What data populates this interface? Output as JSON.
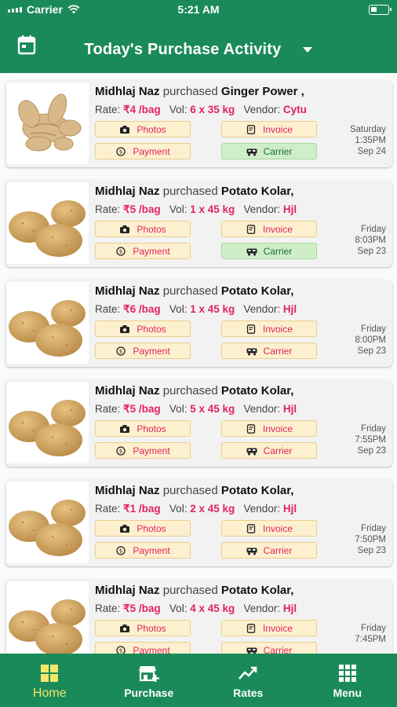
{
  "status": {
    "carrier": "Carrier",
    "time": "5:21 AM"
  },
  "header": {
    "title": "Today's Purchase Activity",
    "calendar_icon": "calendar-icon",
    "dropdown_icon": "caret-down-icon"
  },
  "labels": {
    "purchased": "purchased",
    "rate": "Rate:",
    "vol": "Vol:",
    "vendor": "Vendor:",
    "photos": "Photos",
    "invoice": "Invoice",
    "payment": "Payment",
    "carrier": "Carrier"
  },
  "colors": {
    "brand": "#1b8a5a",
    "accent_red": "#e0245e",
    "button_bg": "#fdf0cf",
    "button_done_bg": "#cfeec8",
    "active_tab": "#f5e66a"
  },
  "activities": [
    {
      "buyer": "Midhlaj Naz",
      "product": "Ginger Power ,",
      "image": "ginger-photo",
      "rate": "₹4 /bag",
      "vol": "6 x 35 kg",
      "vendor": "Cytu",
      "day": "Saturday",
      "time": "1:35PM",
      "date": "Sep 24",
      "carrier_done": true
    },
    {
      "buyer": "Midhlaj Naz",
      "product": "Potato Kolar,",
      "image": "potato-photo",
      "rate": "₹5 /bag",
      "vol": "1 x 45 kg",
      "vendor": "Hjl",
      "day": "Friday",
      "time": "8:03PM",
      "date": "Sep 23",
      "carrier_done": true
    },
    {
      "buyer": "Midhlaj Naz",
      "product": "Potato Kolar,",
      "image": "potato-photo",
      "rate": "₹6 /bag",
      "vol": "1 x 45 kg",
      "vendor": "Hjl",
      "day": "Friday",
      "time": "8:00PM",
      "date": "Sep 23",
      "carrier_done": false
    },
    {
      "buyer": "Midhlaj Naz",
      "product": "Potato Kolar,",
      "image": "potato-photo",
      "rate": "₹5 /bag",
      "vol": "5 x 45 kg",
      "vendor": "Hjl",
      "day": "Friday",
      "time": "7:55PM",
      "date": "Sep 23",
      "carrier_done": false
    },
    {
      "buyer": "Midhlaj Naz",
      "product": "Potato Kolar,",
      "image": "potato-photo",
      "rate": "₹1 /bag",
      "vol": "2 x 45 kg",
      "vendor": "Hjl",
      "day": "Friday",
      "time": "7:50PM",
      "date": "Sep 23",
      "carrier_done": false
    },
    {
      "buyer": "Midhlaj Naz",
      "product": "Potato Kolar,",
      "image": "potato-photo",
      "rate": "₹5 /bag",
      "vol": "4 x 45 kg",
      "vendor": "Hjl",
      "day": "Friday",
      "time": "7:45PM",
      "date": "",
      "carrier_done": false
    }
  ],
  "tabs": [
    {
      "label": "Home",
      "icon": "home-grid-icon",
      "active": true
    },
    {
      "label": "Purchase",
      "icon": "store-add-icon",
      "active": false
    },
    {
      "label": "Rates",
      "icon": "trend-up-icon",
      "active": false
    },
    {
      "label": "Menu",
      "icon": "grid-menu-icon",
      "active": false
    }
  ]
}
